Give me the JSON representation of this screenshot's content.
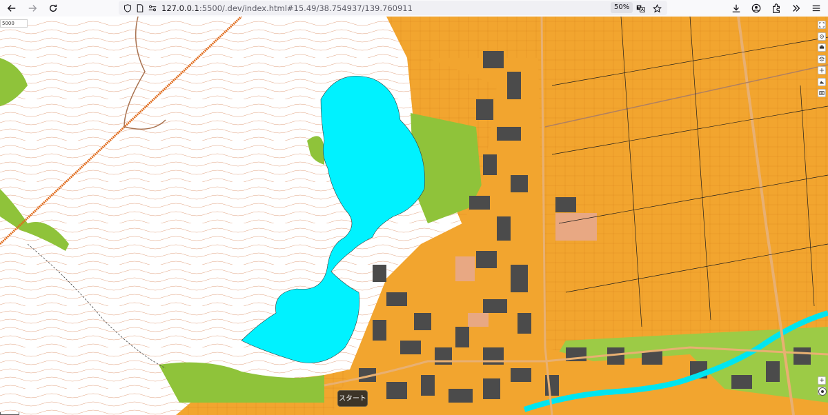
{
  "browser": {
    "url_host": "127.0.0.1",
    "url_rest": ":5500/.dev/index.html#15.49/38.754937/139.760911",
    "zoom_level": "50%"
  },
  "map": {
    "scale_label": "5000",
    "start_label": "スタート",
    "zoom_in_label": "+",
    "zoom_out_label": "−",
    "colors": {
      "paddy": "#f2a52f",
      "forest": "#8fc33a",
      "water": "#00f2ff",
      "building": "#4b4b4b",
      "contour": "#d9926a",
      "road": "#e8b072"
    }
  },
  "icons": [
    "back-icon",
    "forward-icon",
    "reload-icon",
    "shield-icon",
    "page-icon",
    "permissions-icon",
    "translate-icon",
    "bookmark-star-icon",
    "download-icon",
    "account-icon",
    "extensions-icon",
    "overflow-icon",
    "menu-icon",
    "fullscreen-icon",
    "locate-icon",
    "print-icon",
    "layers-icon",
    "crosshair-icon",
    "terrain-icon",
    "legend-icon",
    "compass-icon"
  ]
}
